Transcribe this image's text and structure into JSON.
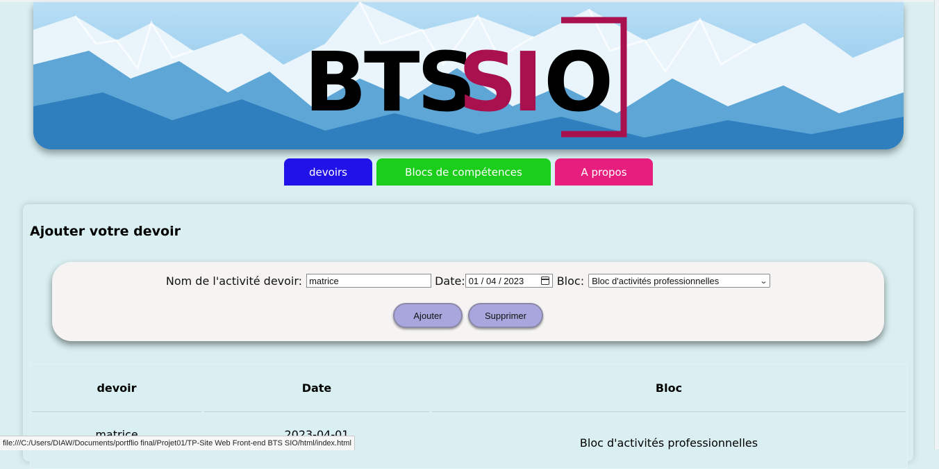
{
  "banner": {
    "logo_text_dark": "BTS",
    "logo_text_accent": "SIO",
    "logo_dark_color": "#000000",
    "logo_accent_color": "#a8104e"
  },
  "nav": {
    "tabs": [
      {
        "label": "devoirs",
        "color": "#2012e8"
      },
      {
        "label": "Blocs de compétences",
        "color": "#1cce1c"
      },
      {
        "label": "A propos",
        "color": "#e81e7e"
      }
    ]
  },
  "main": {
    "title": "Ajouter votre devoir"
  },
  "form": {
    "activity_label": "Nom de l'activité devoir:",
    "activity_value": "matrice",
    "date_label": "Date:",
    "date_value": "01 / 04 / 2023",
    "bloc_label": "Bloc:",
    "bloc_selected": "Bloc d'activités professionnelles",
    "add_label": "Ajouter",
    "delete_label": "Supprimer"
  },
  "table": {
    "headers": [
      "devoir",
      "Date",
      "Bloc"
    ],
    "rows": [
      {
        "devoir": "matrice",
        "date": "2023-04-01",
        "bloc": "Bloc d'activités professionnelles"
      }
    ]
  },
  "status_bar": {
    "url": "file:///C:/Users/DIAW/Documents/portflio final/Projet01/TP-Site Web Front-end BTS SIO/html/index.html"
  }
}
